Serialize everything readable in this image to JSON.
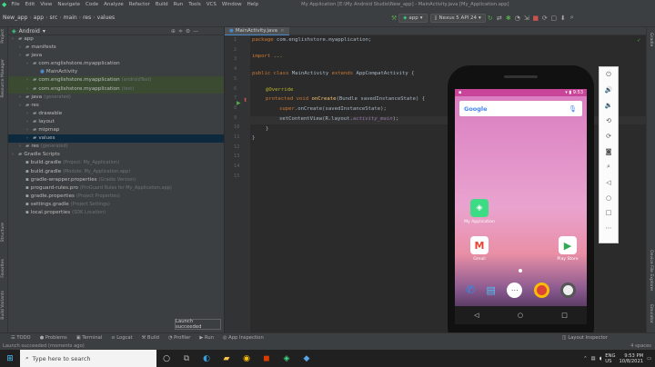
{
  "menu": {
    "items": [
      "File",
      "Edit",
      "View",
      "Navigate",
      "Code",
      "Analyze",
      "Refactor",
      "Build",
      "Run",
      "Tools",
      "VCS",
      "Window",
      "Help"
    ],
    "window_title": "My Application [E:\\My Android Studio\\New_app] - MainActivity.java [My_Application.app]"
  },
  "nav": {
    "crumbs": [
      "New_app",
      "app",
      "src",
      "main",
      "res",
      "values"
    ],
    "run_config": "app",
    "device": "Nexus 5 API 24"
  },
  "project": {
    "view_label": "Android",
    "items": [
      {
        "t": "app",
        "d": 0
      },
      {
        "t": "manifests",
        "d": 1
      },
      {
        "t": "java",
        "d": 1
      },
      {
        "t": "com.englishstore.myapplication",
        "d": 2
      },
      {
        "t": "MainActivity",
        "d": 3
      },
      {
        "t": "com.englishstore.myapplication",
        "d": 2,
        "hint": "(androidTest)"
      },
      {
        "t": "com.englishstore.myapplication",
        "d": 2,
        "hint": "(test)"
      },
      {
        "t": "java",
        "d": 1,
        "hint": "(generated)"
      },
      {
        "t": "res",
        "d": 1
      },
      {
        "t": "drawable",
        "d": 2
      },
      {
        "t": "layout",
        "d": 2
      },
      {
        "t": "mipmap",
        "d": 2
      },
      {
        "t": "values",
        "d": 2
      },
      {
        "t": "res",
        "d": 1,
        "hint": "(generated)"
      },
      {
        "t": "Gradle Scripts",
        "d": 0
      },
      {
        "t": "build.gradle",
        "d": 1,
        "hint": "(Project: My_Application)"
      },
      {
        "t": "build.gradle",
        "d": 1,
        "hint": "(Module: My_Application.app)"
      },
      {
        "t": "gradle-wrapper.properties",
        "d": 1,
        "hint": "(Gradle Version)"
      },
      {
        "t": "proguard-rules.pro",
        "d": 1,
        "hint": "(ProGuard Rules for My_Application.app)"
      },
      {
        "t": "gradle.properties",
        "d": 1,
        "hint": "(Project Properties)"
      },
      {
        "t": "settings.gradle",
        "d": 1,
        "hint": "(Project Settings)"
      },
      {
        "t": "local.properties",
        "d": 1,
        "hint": "(SDK Location)"
      }
    ]
  },
  "editor": {
    "tab": "MainActivity.java",
    "lines": [
      "1",
      "2",
      "3",
      "4",
      "5",
      "6",
      "7",
      "8",
      "9",
      "10",
      "11",
      "12",
      "13",
      "14",
      "15"
    ],
    "code": {
      "l1a": "package",
      "l1b": " com.englishstore.myapplication;",
      "l3a": "import",
      "l3b": " ...",
      "l5a": "public class",
      "l5b": " MainActivity ",
      "l5c": "extends",
      "l5d": " AppCompatActivity {",
      "l7": "@Override",
      "l8a": "protected void",
      "l8b": " onCreate",
      "l8c": "(Bundle savedInstanceState) {",
      "l9a": "super",
      "l9b": ".onCreate(savedInstanceState);",
      "l10a": "setContentView(R.layout.",
      "l10b": "activity_main",
      "l10c": ");",
      "l11": "}",
      "l12": "}"
    }
  },
  "phone": {
    "time": "9:53",
    "search": "Google",
    "app_name": "My Application",
    "gmail": "Gmail",
    "playstore": "Play Store"
  },
  "toast": "Launch succeeded",
  "bottom_tools": [
    "TODO",
    "Problems",
    "Terminal",
    "Logcat",
    "Build",
    "Profiler",
    "Run",
    "App Inspection"
  ],
  "bottom_right": "Layout Inspector",
  "status": {
    "left": "Launch succeeded (moments ago)",
    "right": "4 spaces"
  },
  "taskbar": {
    "search": "Type here to search",
    "lang": "ENG",
    "region": "US",
    "time": "9:53 PM",
    "date": "10/8/2021"
  },
  "side_tabs": {
    "left": [
      "Project",
      "Resource Manager",
      "Structure",
      "Favorites",
      "Build Variants"
    ],
    "right": [
      "Gradle",
      "Device File Explorer",
      "Emulator"
    ]
  }
}
